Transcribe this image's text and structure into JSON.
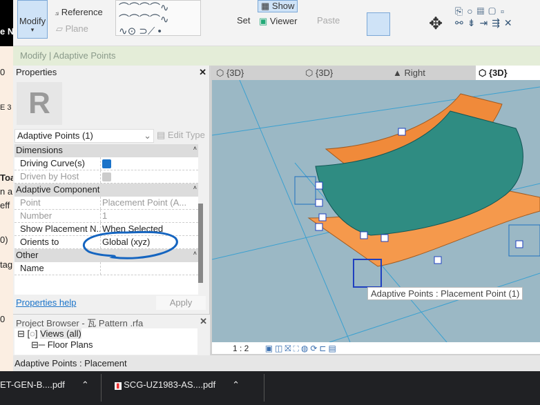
{
  "left_fragments": [
    "e N",
    "0",
    "E 3",
    "Toa",
    "n a",
    "eff",
    "0)",
    "tag",
    "0"
  ],
  "ribbon": {
    "modify": "Modify",
    "reference": "Reference",
    "plane": "Plane",
    "show": "Show",
    "set": "Set",
    "viewer": "Viewer",
    "paste": "Paste"
  },
  "context_bar": "Modify | Adaptive Points",
  "properties": {
    "title": "Properties",
    "close": "✕",
    "type_selector": "Adaptive Points (1)",
    "edit_type": "Edit Type",
    "sections": [
      {
        "name": "Dimensions",
        "rows": [
          {
            "key": "Driving Curve(s)",
            "checked": true
          },
          {
            "key": "Driven by Host",
            "checked": true,
            "disabled": true
          }
        ]
      },
      {
        "name": "Adaptive Component",
        "rows": [
          {
            "key": "Point",
            "value": "Placement Point (A..."
          },
          {
            "key": "Number",
            "value": "1"
          },
          {
            "key": "Show Placement N...",
            "value": "When Selected"
          },
          {
            "key": "Orients to",
            "value": "Global (xyz)"
          }
        ]
      },
      {
        "name": "Other",
        "rows": [
          {
            "key": "Name",
            "value": ""
          }
        ]
      }
    ],
    "help": "Properties help",
    "apply": "Apply"
  },
  "project_browser": {
    "title": "Project Browser - 瓦 Pattern .rfa",
    "close": "✕",
    "items": [
      "Views (all)",
      "Floor Plans"
    ]
  },
  "view_tabs": [
    "{3D}",
    "{3D}",
    "Right",
    "{3D}"
  ],
  "viewport": {
    "scale": "1 : 2",
    "tooltip": "Adaptive Points : Placement Point (1)"
  },
  "status_bar": "Adaptive Points : Placement",
  "taskbar": [
    {
      "label": "ET-GEN-B....pdf"
    },
    {
      "label": "SCG-UZ1983-AS....pdf"
    }
  ],
  "colors": {
    "accent": "#1a73c9",
    "annotation": "#1565c0",
    "view_bg": "#9bb8c5"
  }
}
